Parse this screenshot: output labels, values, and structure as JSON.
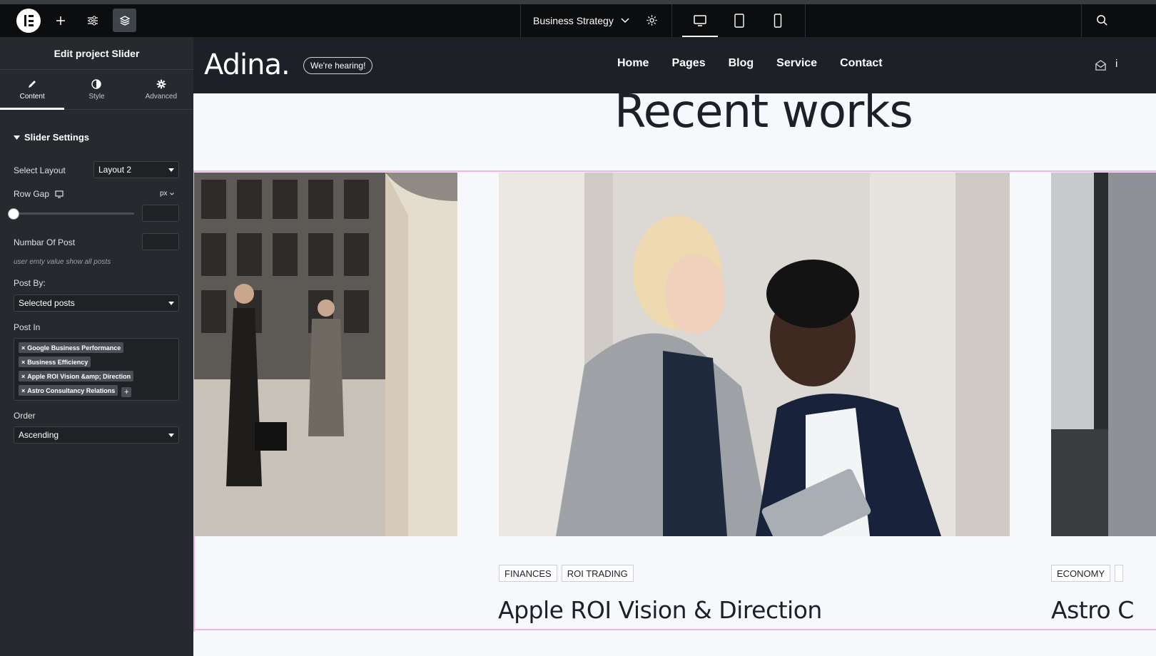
{
  "topbar": {
    "document_title": "Business Strategy",
    "icons": [
      "elementor-logo",
      "add-icon",
      "sliders-icon",
      "layers-icon",
      "chevron-down-icon",
      "gear-icon",
      "desktop-icon",
      "tablet-icon",
      "mobile-icon",
      "search-icon"
    ]
  },
  "panel": {
    "title": "Edit project Slider",
    "tabs": [
      {
        "label": "Content",
        "active": true
      },
      {
        "label": "Style",
        "active": false
      },
      {
        "label": "Advanced",
        "active": false
      }
    ],
    "section_title": "Slider Settings",
    "select_layout_label": "Select Layout",
    "select_layout_value": "Layout 2",
    "row_gap_label": "Row Gap",
    "row_gap_unit": "px",
    "row_gap_value": "",
    "number_of_post_label": "Numbar Of Post",
    "number_of_post_value": "",
    "number_hint": "user emty value show all posts",
    "post_by_label": "Post By:",
    "post_by_value": "Selected posts",
    "post_in_label": "Post In",
    "post_in_tags": [
      "Google Business Performance",
      "Business Efficiency",
      "Apple ROI Vision &amp; Direction",
      "Astro Consultancy Relations"
    ],
    "order_label": "Order",
    "order_value": "Ascending"
  },
  "site": {
    "logo": "Adina.",
    "pill": "We're hearing!",
    "nav": [
      "Home",
      "Pages",
      "Blog",
      "Service",
      "Contact"
    ],
    "edge_text": "i",
    "heading": "Recent works"
  },
  "cards": [
    {
      "categories": [
        "FINANCES",
        "ROI TRADING"
      ],
      "title": "Apple ROI Vision & Direction"
    },
    {
      "categories": [
        "ECONOMY"
      ],
      "title": "Astro C"
    }
  ],
  "colors": {
    "editor_bg": "#26292d",
    "topbar_bg": "#0c0d0e",
    "site_header_bg": "#1d2127",
    "canvas_bg": "#f6f8fc",
    "selection_outline": "#f3b4e6"
  }
}
